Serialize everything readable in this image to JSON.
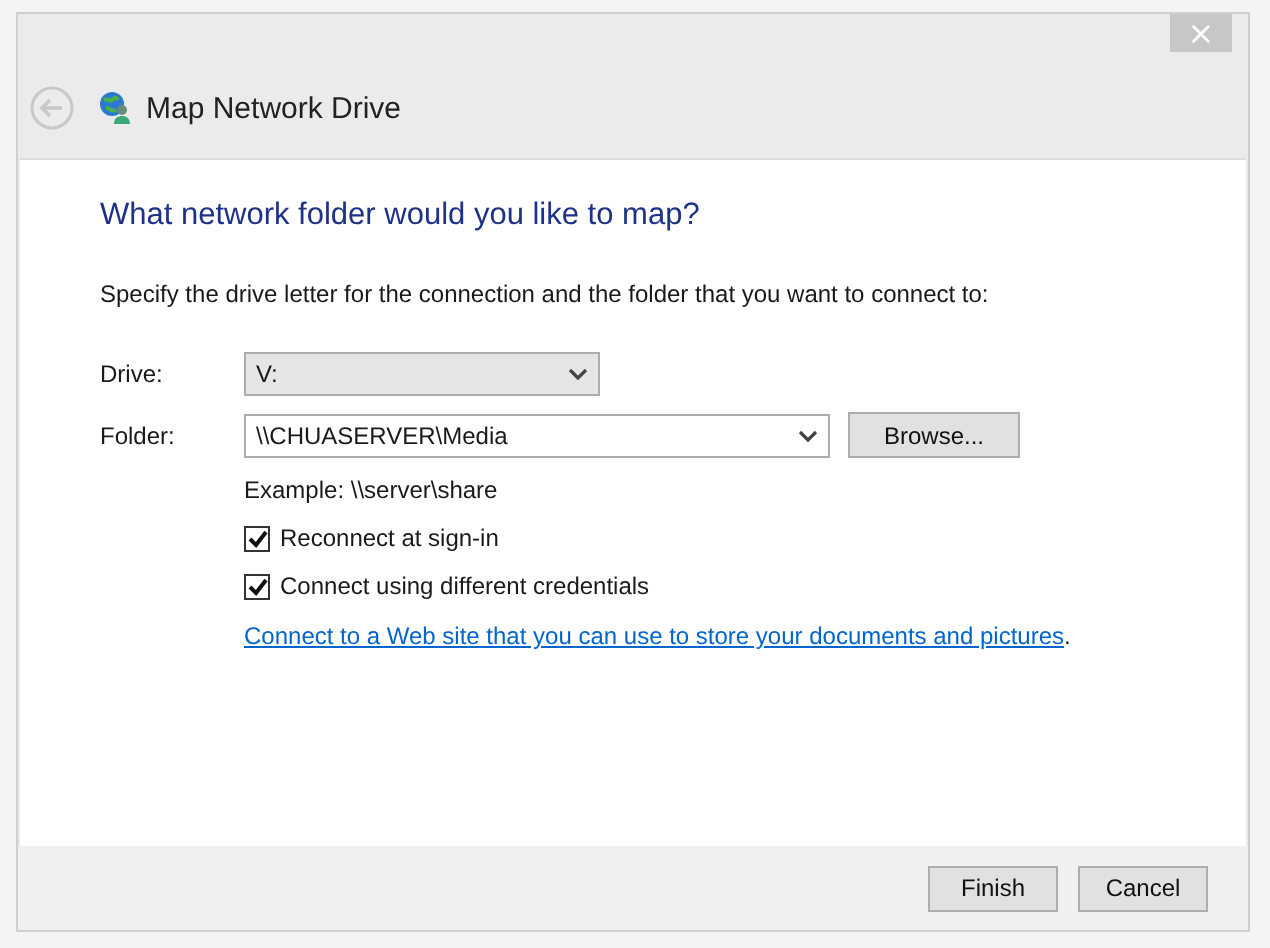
{
  "window": {
    "title": "Map Network Drive",
    "close": "×"
  },
  "heading": "What network folder would you like to map?",
  "description": "Specify the drive letter for the connection and the folder that you want to connect to:",
  "drive": {
    "label": "Drive:",
    "value": "V:"
  },
  "folder": {
    "label": "Folder:",
    "value": "\\\\CHUASERVER\\Media",
    "browse": "Browse..."
  },
  "example": "Example: \\\\server\\share",
  "options": [
    {
      "label": "Reconnect at sign-in",
      "checked": true
    },
    {
      "label": "Connect using different credentials",
      "checked": true
    }
  ],
  "link": {
    "text": "Connect to a Web site that you can use to store your documents and pictures",
    "suffix": "."
  },
  "buttons": [
    "Finish",
    "Cancel"
  ]
}
